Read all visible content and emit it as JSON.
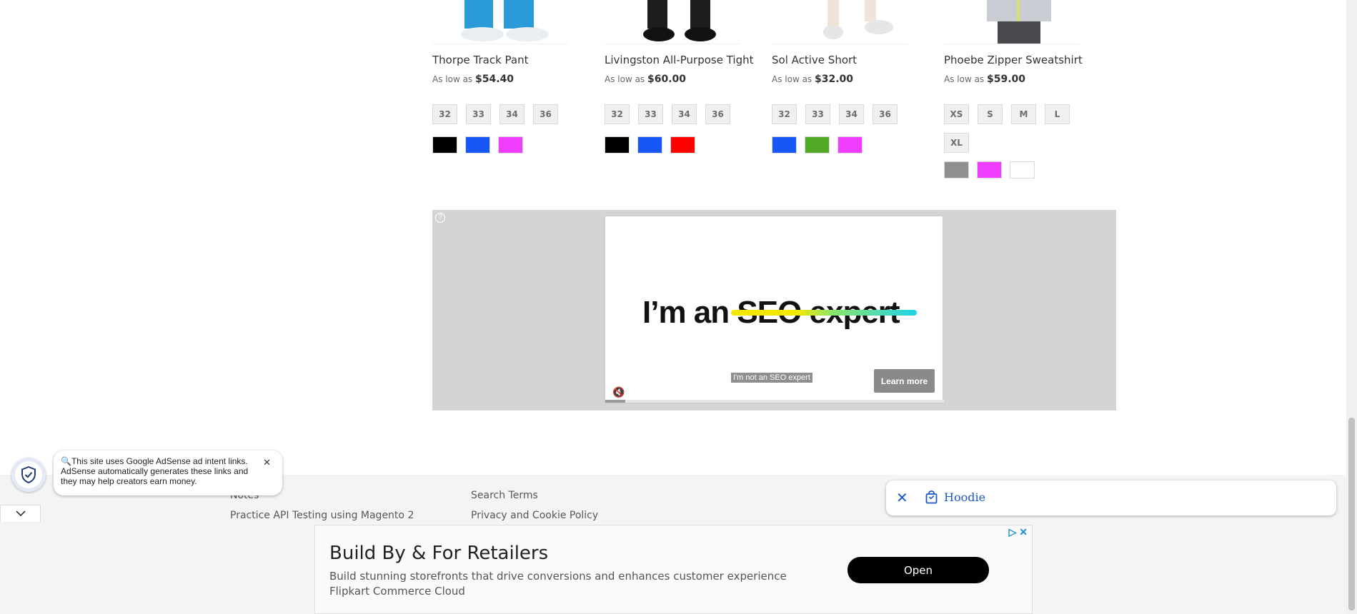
{
  "products": [
    {
      "name": "Thorpe Track Pant",
      "price_prefix": "As low as",
      "price": "$54.40",
      "sizes": [
        "32",
        "33",
        "34",
        "36"
      ],
      "colors": [
        "#000000",
        "#1857f7",
        "#ef3dff"
      ]
    },
    {
      "name": "Livingston All-Purpose Tight",
      "price_prefix": "As low as",
      "price": "$60.00",
      "sizes": [
        "32",
        "33",
        "34",
        "36"
      ],
      "colors": [
        "#000000",
        "#1857f7",
        "#ff0000"
      ]
    },
    {
      "name": "Sol Active Short",
      "price_prefix": "As low as",
      "price": "$32.00",
      "sizes": [
        "32",
        "33",
        "34",
        "36"
      ],
      "colors": [
        "#1857f7",
        "#53a828",
        "#ef3dff"
      ]
    },
    {
      "name": "Phoebe Zipper Sweatshirt",
      "price_prefix": "As low as",
      "price": "$59.00",
      "sizes": [
        "XS",
        "S",
        "M",
        "L",
        "XL"
      ],
      "colors": [
        "#8f8f8f",
        "#ef3dff",
        "#ffffff"
      ]
    }
  ],
  "display_ad": {
    "help_glyph": "?",
    "headline": "I’m an SEO expert",
    "subline": "I'm not an SEO expert",
    "cta": "Learn more",
    "mute_glyph": "🔇",
    "progress": 0.06
  },
  "footer": {
    "links": [
      "Notes",
      "Practice API Testing using Magento 2",
      "Search Terms",
      "Privacy and Cookie Policy"
    ]
  },
  "adsense_notice": {
    "text": "This site uses Google AdSense ad intent links. AdSense automatically generates these links and they may help creators earn money.",
    "close_glyph": "✕",
    "collapse_glyph": "⌄"
  },
  "search_chip": {
    "close_glyph": "✕",
    "label": "Hoodie"
  },
  "bottom_ad": {
    "title": "Build By & For Retailers",
    "description": "Build stunning storefronts that drive conversions and enhances customer experience",
    "source": "Flipkart Commerce Cloud",
    "cta": "Open",
    "adchoices_glyph": "▷ ✕"
  },
  "colors": {
    "link_blue": "#1a57c8",
    "footer_bg": "#f4f4f4",
    "ad_bg": "#d4d4d4"
  }
}
